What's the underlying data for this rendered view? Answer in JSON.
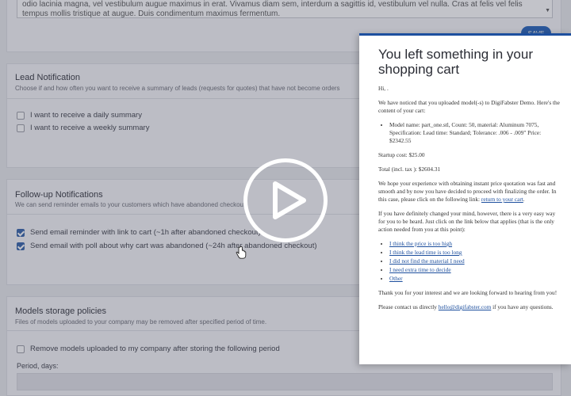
{
  "top": {
    "textarea_text": "odio lacinia magna, vel vestibulum augue maximus in erat. Vivamus diam sem, interdum a sagittis id, vestibulum vel nulla. Cras at felis vel felis tempus mollis tristique at augue. Duis condimentum maximus fermentum.",
    "save_label": "SAVE"
  },
  "lead": {
    "title": "Lead Notification",
    "desc": "Choose if and how often you want to receive a summary of leads (requests for quotes) that have not become orders",
    "daily": "I want to receive a daily summary",
    "weekly": "I want to receive a weekly summary"
  },
  "followup": {
    "title": "Follow-up Notifications",
    "desc": "We can send reminder emails to your customers which have abandoned checkout",
    "opt1": "Send email reminder with link to cart (~1h after abandoned checkout)",
    "opt2": "Send email with poll about why cart was abandoned (~24h after abandoned checkout)"
  },
  "storage": {
    "title": "Models storage policies",
    "desc": "Files of models uploaded to your company may be removed after specified period of time.",
    "remove": "Remove models uploaded to my company after storing the following period",
    "period_label": "Period, days:"
  },
  "email": {
    "title": "You left something in your shopping cart",
    "greeting": "Hi, .",
    "intro": "We have noticed that you uploaded model(-s) to DigiFabster Demo. Here's the content of your cart:",
    "item": "Model name: part_one.stl, Count: 50, material: Aluminum 7075, Specification: Lead time: Standard; Tolerance: .006 - .009\" Price: $2342.55",
    "startup": "Startup cost: $25.00",
    "total": "Total (incl. tax ): $2604.31",
    "hope": "We hope your experience with obtaining instant price quotation was fast and smooth and by now you have decided to proceed with finalizing the order. In this case, please click on the following link:",
    "return_link": "return to your cart",
    "changed": "If you have definitely changed your mind, however, there is a very easy way for you to be heard. Just click on the link below that applies (that is the only action needed from you at this point):",
    "reasons": [
      "I think the price is too high",
      "I think the lead time is too long",
      "I did not find the material I need",
      "I need extra time to decide",
      "Other"
    ],
    "thanks": "Thank you for your interest and we are looking forward to hearing from you!",
    "contact_pre": "Please contact us directly",
    "contact_email": "hello@digifabster.com",
    "contact_post": "if you have any questions."
  },
  "icons": {
    "play": "play-icon",
    "cursor": "hand-pointer-icon",
    "checkbox": "checkbox-icon"
  },
  "colors": {
    "accent": "#1d4f9e",
    "checked": "#2f5fa8"
  }
}
